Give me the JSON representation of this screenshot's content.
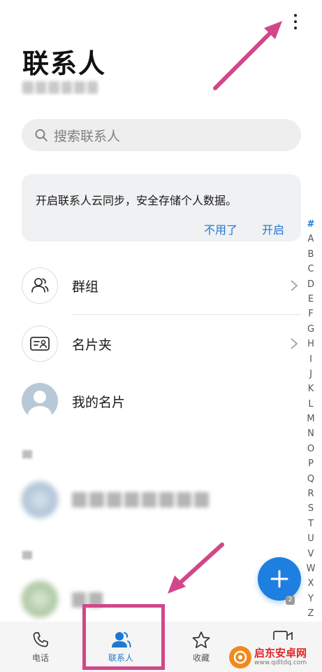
{
  "header": {
    "title": "联系人"
  },
  "search": {
    "placeholder": "搜索联系人"
  },
  "sync_card": {
    "message": "开启联系人云同步，安全存储个人数据。",
    "dismiss_label": "不用了",
    "enable_label": "开启"
  },
  "rows": [
    {
      "label": "群组",
      "icon": "group-icon"
    },
    {
      "label": "名片夹",
      "icon": "business-card-icon"
    },
    {
      "label": "我的名片",
      "icon": "avatar"
    }
  ],
  "index_letters": [
    "#",
    "A",
    "B",
    "C",
    "D",
    "E",
    "F",
    "G",
    "H",
    "I",
    "J",
    "K",
    "L",
    "M",
    "N",
    "O",
    "P",
    "Q",
    "R",
    "S",
    "T",
    "U",
    "V",
    "W",
    "X",
    "Y",
    "Z"
  ],
  "fab": {
    "icon": "plus-icon",
    "badge": "2"
  },
  "bottom_nav": [
    {
      "label": "电话",
      "icon": "phone-icon",
      "active": false
    },
    {
      "label": "联系人",
      "icon": "contacts-icon",
      "active": true
    },
    {
      "label": "收藏",
      "icon": "star-icon",
      "active": false
    }
  ],
  "watermark": {
    "title": "启东安卓网",
    "url": "www.qdltdq.com"
  },
  "colors": {
    "accent": "#1e78d2",
    "fab": "#1e7fe0",
    "annotation": "#d1478a",
    "watermark_red": "#e0262a",
    "watermark_orange": "#f08a1c"
  }
}
